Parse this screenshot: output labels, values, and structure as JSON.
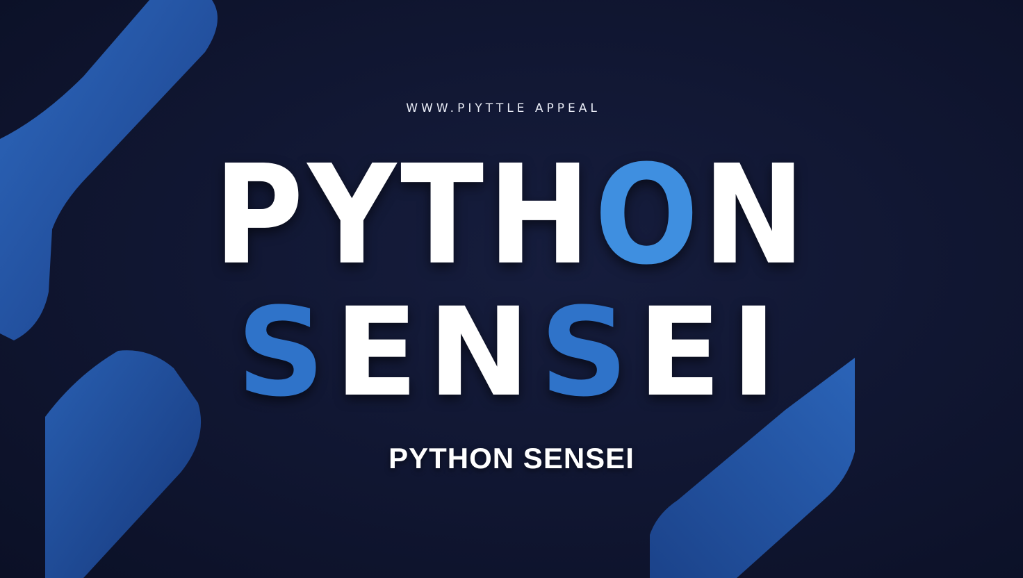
{
  "banner": {
    "url_text": "WWW.PIYTTLE APPEAL",
    "title_line1": {
      "part1": "PYTH",
      "part2": "O",
      "part3": "N"
    },
    "title_line2": {
      "part1": "S",
      "part2": "EN",
      "part3": "S",
      "part4": "EI"
    },
    "subtitle": "PYTHON SENSEI"
  },
  "colors": {
    "background": "#111733",
    "accent_blue": "#2f73c9",
    "text": "#ffffff"
  }
}
